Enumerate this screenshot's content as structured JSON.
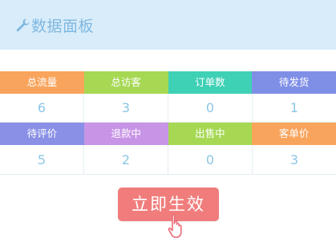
{
  "header": {
    "title": "数据面板",
    "icon": "wrench-icon",
    "background": "#d8ecfa",
    "title_color": "#7fb8e0"
  },
  "stats_row1": [
    {
      "label": "总流量",
      "value": "6",
      "color": "#f9a45c"
    },
    {
      "label": "总访客",
      "value": "3",
      "color": "#a6d853"
    },
    {
      "label": "订单数",
      "value": "0",
      "color": "#3fd1b5"
    },
    {
      "label": "待发货",
      "value": "1",
      "color": "#7f8fe6"
    }
  ],
  "stats_row2": [
    {
      "label": "待评价",
      "value": "5",
      "color": "#8a90e6"
    },
    {
      "label": "退款中",
      "value": "2",
      "color": "#c894e6"
    },
    {
      "label": "出售中",
      "value": "0",
      "color": "#a6d853"
    },
    {
      "label": "客单价",
      "value": "3",
      "color": "#f9a45c"
    }
  ],
  "apply_button": {
    "label": "立即生效",
    "color": "#f07d7c"
  },
  "cursor": {
    "icon": "pointer-cursor-icon"
  }
}
